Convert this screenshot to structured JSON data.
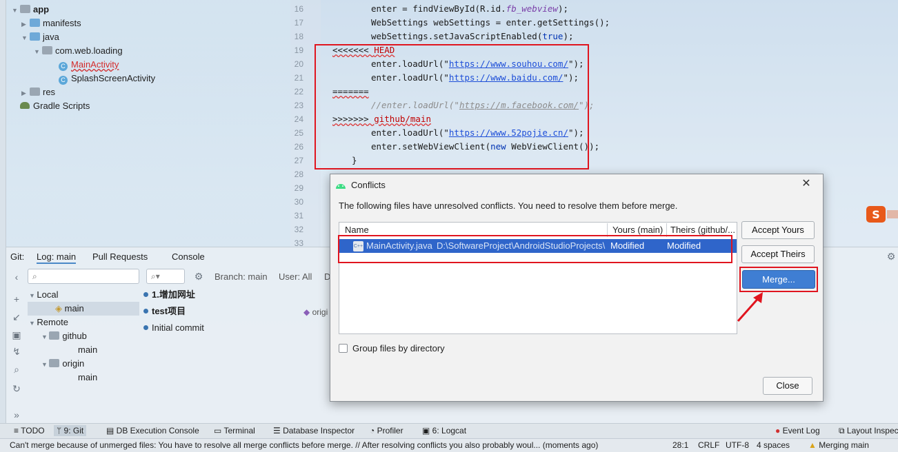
{
  "project_tree": {
    "items": [
      {
        "label": "app",
        "bold": true
      },
      {
        "label": "manifests"
      },
      {
        "label": "java"
      },
      {
        "label": "com.web.loading"
      },
      {
        "label": "MainActivity"
      },
      {
        "label": "SplashScreenActivity"
      },
      {
        "label": "res"
      },
      {
        "label": "Gradle Scripts"
      }
    ]
  },
  "editor": {
    "line_numbers": [
      "16",
      "17",
      "18",
      "19",
      "20",
      "21",
      "22",
      "23",
      "24",
      "25",
      "26",
      "27",
      "28",
      "29",
      "30",
      "31",
      "32",
      "33"
    ],
    "lines": {
      "l16a": "enter = findViewById(R.id.",
      "l16b": "fb_webview",
      "l16c": ");",
      "l17a": "WebSettings webSettings = enter.getSettings();",
      "l18a": "webSettings.setJavaScriptEnabled(",
      "l18b": "true",
      "l18c": ");",
      "l19a": "<<<<<<< ",
      "l19b": "HEAD",
      "l20a": "enter.loadUrl(\"",
      "l20b": "https://www.souhou.com/",
      "l20c": "\");",
      "l21a": "enter.loadUrl(\"",
      "l21b": "https://www.baidu.com/",
      "l21c": "\");",
      "l22a": "=======",
      "l23a": "//enter.loadUrl(\"",
      "l23b": "https://m.facebook.com/",
      "l23c": "\");",
      "l24a": ">>>>>>> ",
      "l24b": "github/main",
      "l25a": "enter.loadUrl(\"",
      "l25b": "https://www.52pojie.cn/",
      "l25c": "\");",
      "l26a": "enter.setWebViewClient(",
      "l26b": "new",
      "l26c": " WebViewClient());",
      "l27a": "}"
    }
  },
  "git_panel": {
    "tabs": [
      "Git:",
      "Log: main",
      "Pull Requests",
      "Console"
    ],
    "search_placeholder": "",
    "filter": {
      "branch": "Branch: main",
      "user": "User: All",
      "date": "D"
    },
    "branches": {
      "local_label": "Local",
      "local_main": "main",
      "remote_label": "Remote",
      "github": "github",
      "github_main": "main",
      "origin": "origin",
      "origin_main": "main"
    },
    "commits": [
      "1.增加网址",
      "test项目",
      "Initial commit"
    ],
    "tag_label": "origi"
  },
  "dialog": {
    "title": "Conflicts",
    "message": "The following files have unresolved conflicts. You need to resolve them before merge.",
    "columns": {
      "name": "Name",
      "yours": "Yours (main)",
      "theirs": "Theirs (github/..."
    },
    "row": {
      "file": "MainActivity.java",
      "path": "D:\\SoftwareProject\\AndroidStudioProjects\\",
      "yours": "Modified",
      "theirs": "Modified"
    },
    "buttons": {
      "accept_yours": "Accept Yours",
      "accept_theirs": "Accept Theirs",
      "merge": "Merge...",
      "close": "Close"
    },
    "checkbox_label": "Group files by directory"
  },
  "tool_bar": {
    "items": [
      "TODO",
      "9: Git",
      "DB Execution Console",
      "Terminal",
      "Database Inspector",
      "Profiler",
      "6: Logcat",
      "Event Log",
      "Layout Inspec"
    ]
  },
  "status_bar": {
    "message": "Can't merge because of unmerged files: You have to resolve all merge conflicts before merge. // After resolving conflicts you also probably woul... (moments ago)",
    "position": "28:1",
    "line_sep": "CRLF",
    "encoding": "UTF-8",
    "indent": "4 spaces",
    "vcs": "Merging main"
  },
  "colors": {
    "accent": "#3f7ed3",
    "annotation": "#e0141e",
    "selection": "#2f65ca"
  }
}
